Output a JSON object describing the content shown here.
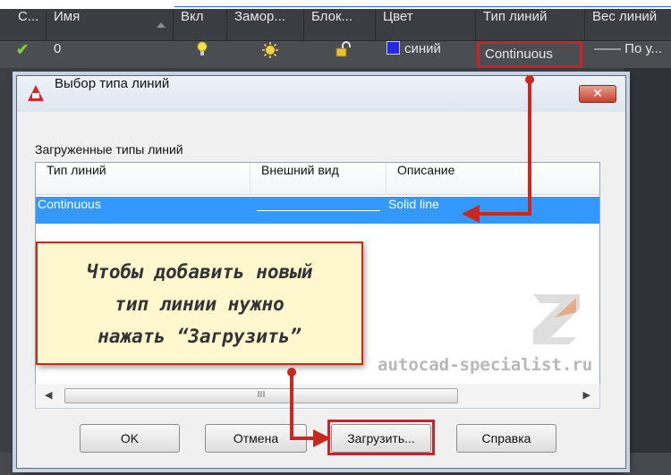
{
  "layer_manager": {
    "columns": [
      "С...",
      "Имя",
      "Вкл",
      "Замор...",
      "Блок...",
      "Цвет",
      "Тип линий",
      "Вес линий"
    ],
    "row": {
      "name": "0",
      "color_name": "синий",
      "linetype": "Continuous",
      "lineweight": "По у..."
    },
    "colors": {
      "selected_color": "#1f2be8",
      "status_check": "#7cd03a"
    }
  },
  "dialog": {
    "title": "Выбор типа линий",
    "close_label": "✕",
    "loaded_label": "Загруженные типы линий",
    "columns": [
      "Тип линий",
      "Внешний вид",
      "Описание"
    ],
    "rows": [
      {
        "linetype": "Continuous",
        "description": "Solid line"
      }
    ],
    "scroll_grip": "III",
    "buttons": {
      "ok": "OK",
      "cancel": "Отмена",
      "load": "Загрузить...",
      "help": "Справка"
    }
  },
  "callout": {
    "lines": [
      "Чтобы добавить новый",
      "тип линии нужно",
      "нажать “Загрузить”"
    ]
  },
  "watermark": {
    "text": "autocad-specialist.ru"
  },
  "accent_color": "#d0202c",
  "selection_color": "#3399ff"
}
